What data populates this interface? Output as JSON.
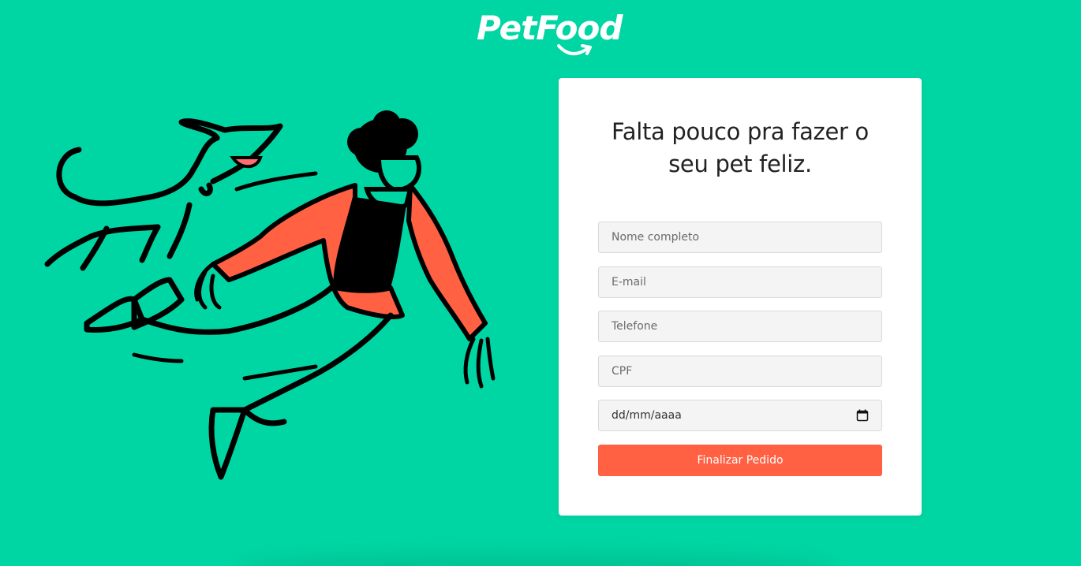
{
  "logo": {
    "text": "PetFood"
  },
  "illustration": {
    "description_icon": "person-and-dog-illustration"
  },
  "form": {
    "title": "Falta pouco pra fazer o seu pet feliz.",
    "fields": {
      "name": {
        "placeholder": "Nome completo",
        "value": ""
      },
      "email": {
        "placeholder": "E-mail",
        "value": ""
      },
      "phone": {
        "placeholder": "Telefone",
        "value": ""
      },
      "cpf": {
        "placeholder": "CPF",
        "value": ""
      },
      "birthdate": {
        "placeholder": "dd/mm/aaaa",
        "value": ""
      }
    },
    "submit_label": "Finalizar Pedido"
  },
  "colors": {
    "background": "#00d6a3",
    "accent": "#ff6142",
    "card": "#ffffff",
    "input_bg": "#f4f4f4"
  }
}
